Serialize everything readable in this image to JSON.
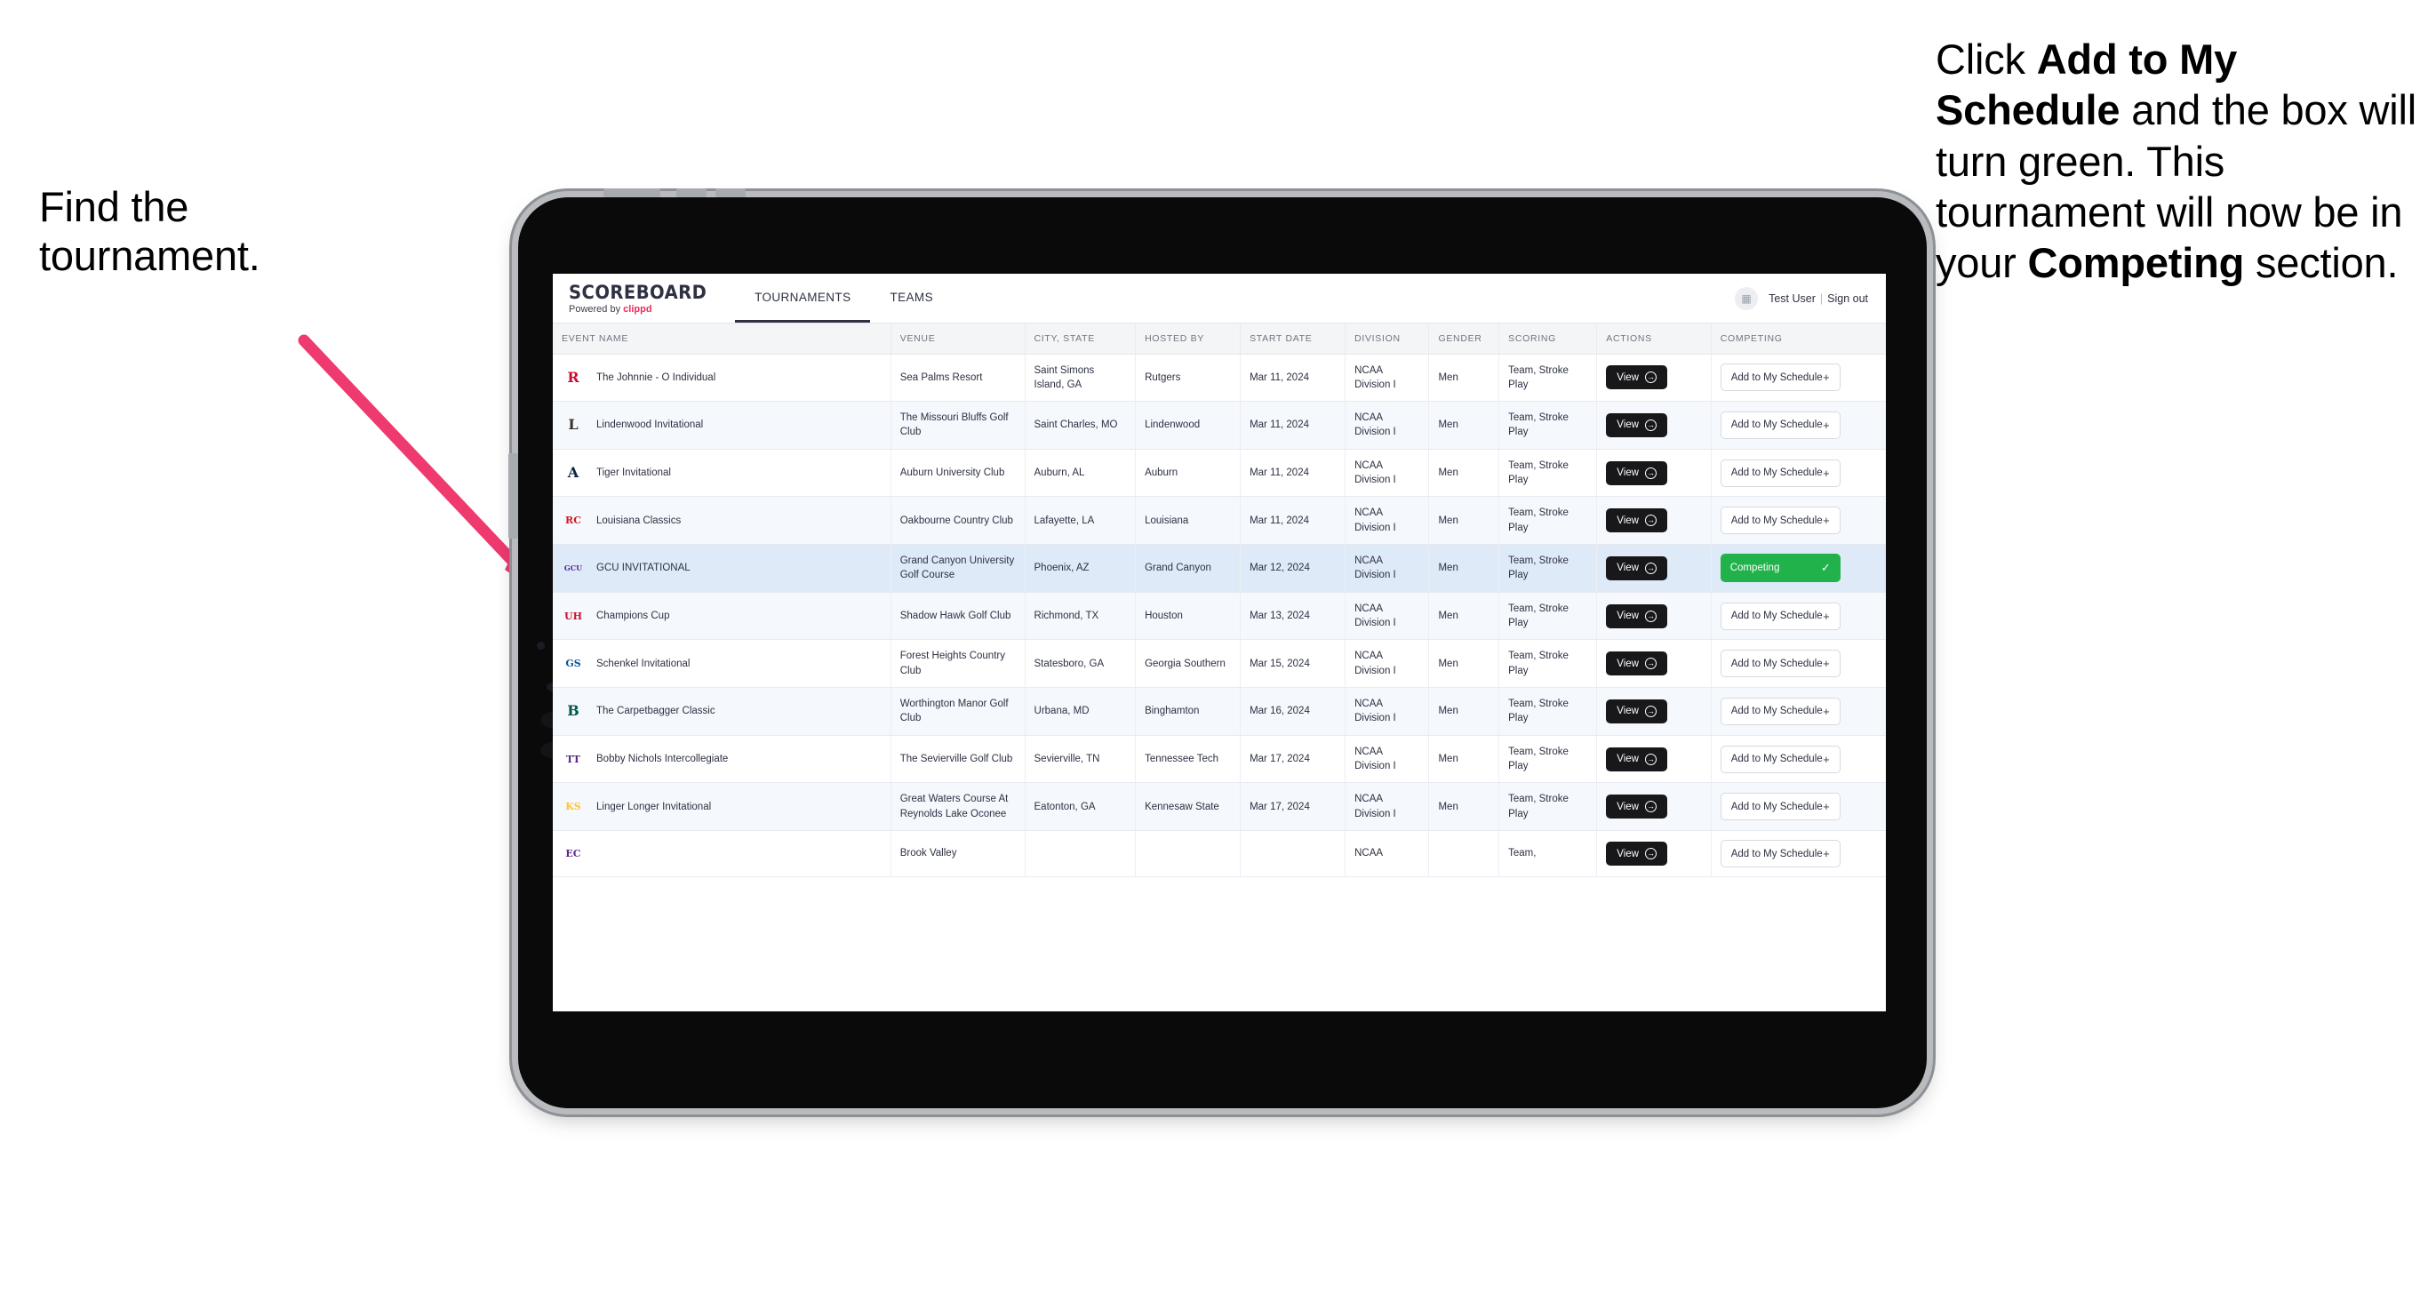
{
  "annotations": {
    "left": "Find the tournament.",
    "right_parts": [
      {
        "t": "Click ",
        "b": false
      },
      {
        "t": "Add to My Schedule",
        "b": true
      },
      {
        "t": " and the box will turn green. This tournament will now be in your ",
        "b": false
      },
      {
        "t": "Competing",
        "b": true
      },
      {
        "t": " section.",
        "b": false
      }
    ],
    "arrow_color": "#ee3a6e"
  },
  "app": {
    "brand": {
      "title": "SCOREBOARD",
      "powered_prefix": "Powered by ",
      "powered_brand": "clippd"
    },
    "nav": [
      {
        "label": "TOURNAMENTS",
        "active": true
      },
      {
        "label": "TEAMS",
        "active": false
      }
    ],
    "header_right": {
      "avatar_icon": "user-avatar-icon",
      "user": "Test User",
      "separator": "|",
      "signout": "Sign out"
    },
    "accent_green": "#22b24c",
    "accent_pink": "#ef2b5c"
  },
  "table": {
    "columns": [
      "EVENT NAME",
      "VENUE",
      "CITY, STATE",
      "HOSTED BY",
      "START DATE",
      "DIVISION",
      "GENDER",
      "SCORING",
      "ACTIONS",
      "COMPETING"
    ],
    "view_label": "View",
    "add_label": "Add to My Schedule",
    "competing_label": "Competing",
    "rows": [
      {
        "logo": "R",
        "logo_color": "#c8102e",
        "name": "The Johnnie - O Individual",
        "venue": "Sea Palms Resort",
        "city": "Saint Simons Island, GA",
        "host": "Rutgers",
        "date": "Mar 11, 2024",
        "division": "NCAA Division I",
        "gender": "Men",
        "scoring": "Team, Stroke Play",
        "competing": false
      },
      {
        "logo": "L",
        "logo_color": "#3a3226",
        "name": "Lindenwood Invitational",
        "venue": "The Missouri Bluffs Golf Club",
        "city": "Saint Charles, MO",
        "host": "Lindenwood",
        "date": "Mar 11, 2024",
        "division": "NCAA Division I",
        "gender": "Men",
        "scoring": "Team, Stroke Play",
        "competing": false
      },
      {
        "logo": "A",
        "logo_color": "#0c2340",
        "name": "Tiger Invitational",
        "venue": "Auburn University Club",
        "city": "Auburn, AL",
        "host": "Auburn",
        "date": "Mar 11, 2024",
        "division": "NCAA Division I",
        "gender": "Men",
        "scoring": "Team, Stroke Play",
        "competing": false
      },
      {
        "logo": "RC",
        "logo_color": "#ce181e",
        "name": "Louisiana Classics",
        "venue": "Oakbourne Country Club",
        "city": "Lafayette, LA",
        "host": "Louisiana",
        "date": "Mar 11, 2024",
        "division": "NCAA Division I",
        "gender": "Men",
        "scoring": "Team, Stroke Play",
        "competing": false
      },
      {
        "logo": "GCU",
        "logo_color": "#522398",
        "name": "GCU INVITATIONAL",
        "venue": "Grand Canyon University Golf Course",
        "city": "Phoenix, AZ",
        "host": "Grand Canyon",
        "date": "Mar 12, 2024",
        "division": "NCAA Division I",
        "gender": "Men",
        "scoring": "Team, Stroke Play",
        "competing": true
      },
      {
        "logo": "UH",
        "logo_color": "#c8102e",
        "name": "Champions Cup",
        "venue": "Shadow Hawk Golf Club",
        "city": "Richmond, TX",
        "host": "Houston",
        "date": "Mar 13, 2024",
        "division": "NCAA Division I",
        "gender": "Men",
        "scoring": "Team, Stroke Play",
        "competing": false
      },
      {
        "logo": "GS",
        "logo_color": "#0058a0",
        "name": "Schenkel Invitational",
        "venue": "Forest Heights Country Club",
        "city": "Statesboro, GA",
        "host": "Georgia Southern",
        "date": "Mar 15, 2024",
        "division": "NCAA Division I",
        "gender": "Men",
        "scoring": "Team, Stroke Play",
        "competing": false
      },
      {
        "logo": "B",
        "logo_color": "#00594c",
        "name": "The Carpetbagger Classic",
        "venue": "Worthington Manor Golf Club",
        "city": "Urbana, MD",
        "host": "Binghamton",
        "date": "Mar 16, 2024",
        "division": "NCAA Division I",
        "gender": "Men",
        "scoring": "Team, Stroke Play",
        "competing": false
      },
      {
        "logo": "TT",
        "logo_color": "#53267f",
        "name": "Bobby Nichols Intercollegiate",
        "venue": "The Sevierville Golf Club",
        "city": "Sevierville, TN",
        "host": "Tennessee Tech",
        "date": "Mar 17, 2024",
        "division": "NCAA Division I",
        "gender": "Men",
        "scoring": "Team, Stroke Play",
        "competing": false
      },
      {
        "logo": "KS",
        "logo_color": "#ffc629",
        "name": "Linger Longer Invitational",
        "venue": "Great Waters Course At Reynolds Lake Oconee",
        "city": "Eatonton, GA",
        "host": "Kennesaw State",
        "date": "Mar 17, 2024",
        "division": "NCAA Division I",
        "gender": "Men",
        "scoring": "Team, Stroke Play",
        "competing": false
      },
      {
        "logo": "EC",
        "logo_color": "#592a8a",
        "name": "",
        "venue": "Brook Valley",
        "city": "",
        "host": "",
        "date": "",
        "division": "NCAA",
        "gender": "",
        "scoring": "Team,",
        "competing": false,
        "partial": true
      }
    ]
  }
}
